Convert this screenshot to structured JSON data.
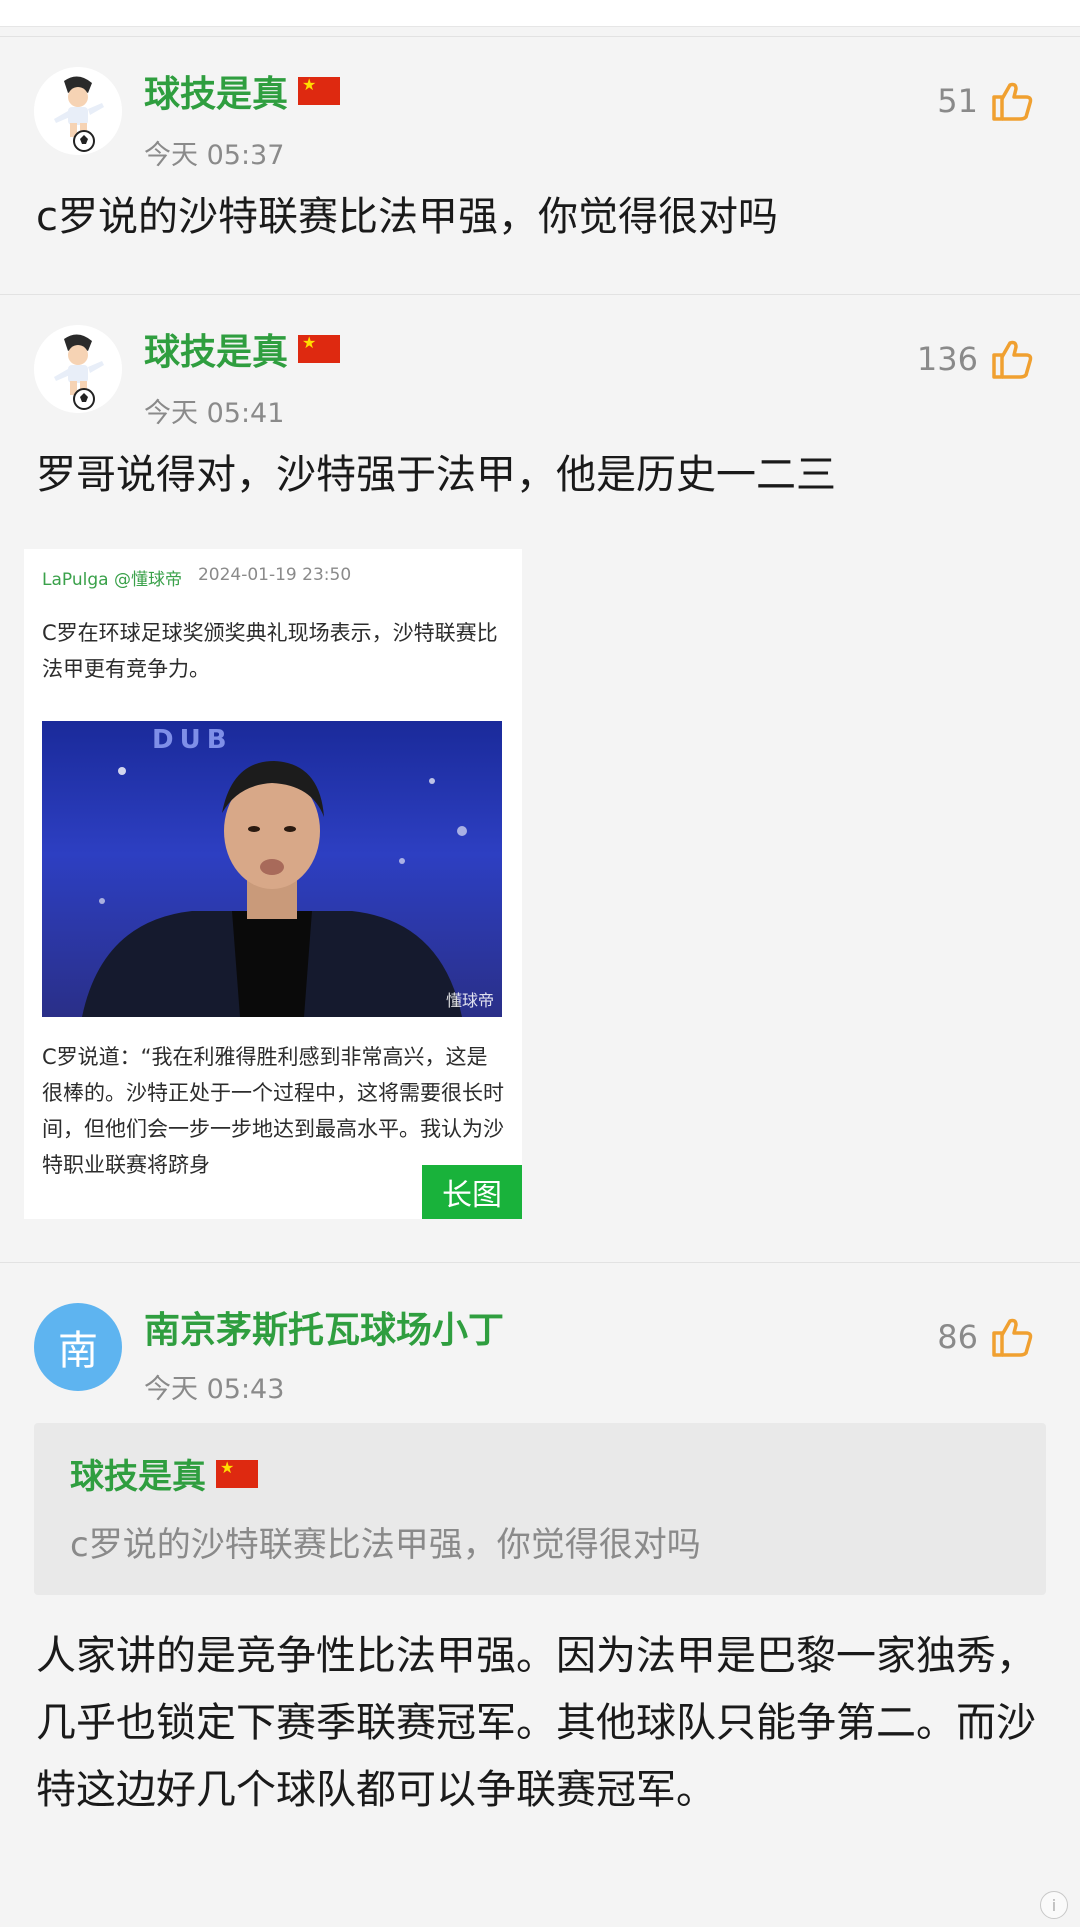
{
  "comments": [
    {
      "username": "球技是真",
      "time": "今天 05:37",
      "likes": "51",
      "text": "c罗说的沙特联赛比法甲强，你觉得很对吗",
      "avatar_icon": "cartoon-soccer-player"
    },
    {
      "username": "球技是真",
      "time": "今天 05:41",
      "likes": "136",
      "text": "罗哥说得对，沙特强于法甲，他是历史一二三",
      "avatar_icon": "cartoon-soccer-player",
      "attached_image": {
        "source": "LaPulga @懂球帝",
        "date": "2024-01-19 23:50",
        "para1": "C罗在环球足球奖颁奖典礼现场表示，沙特联赛比法甲更有竞争力。",
        "photo_watermark": "懂球帝",
        "photo_bg_text": "DUB",
        "para2": "C罗说道：“我在利雅得胜利感到非常高兴，这是很棒的。沙特正处于一个过程中，这将需要很长时间，但他们会一步一步地达到最高水平。我认为沙特职业联赛将跻身",
        "badge": "长图"
      }
    },
    {
      "username": "南京茅斯托瓦球场小丁",
      "avatar_letter": "南",
      "time": "今天 05:43",
      "likes": "86",
      "quote": {
        "username": "球技是真",
        "text": "c罗说的沙特联赛比法甲强，你觉得很对吗"
      },
      "text": "人家讲的是竞争性比法甲强。因为法甲是巴黎一家独秀，几乎也锁定下赛季联赛冠军。其他球队只能争第二。而沙特这边好几个球队都可以争联赛冠军。"
    }
  ],
  "colors": {
    "username": "#2f9e3f",
    "like_icon": "#f0a030",
    "badge": "#19b23b",
    "avatar_letter_bg": "#5eb4f0"
  },
  "info_icon_label": "i"
}
